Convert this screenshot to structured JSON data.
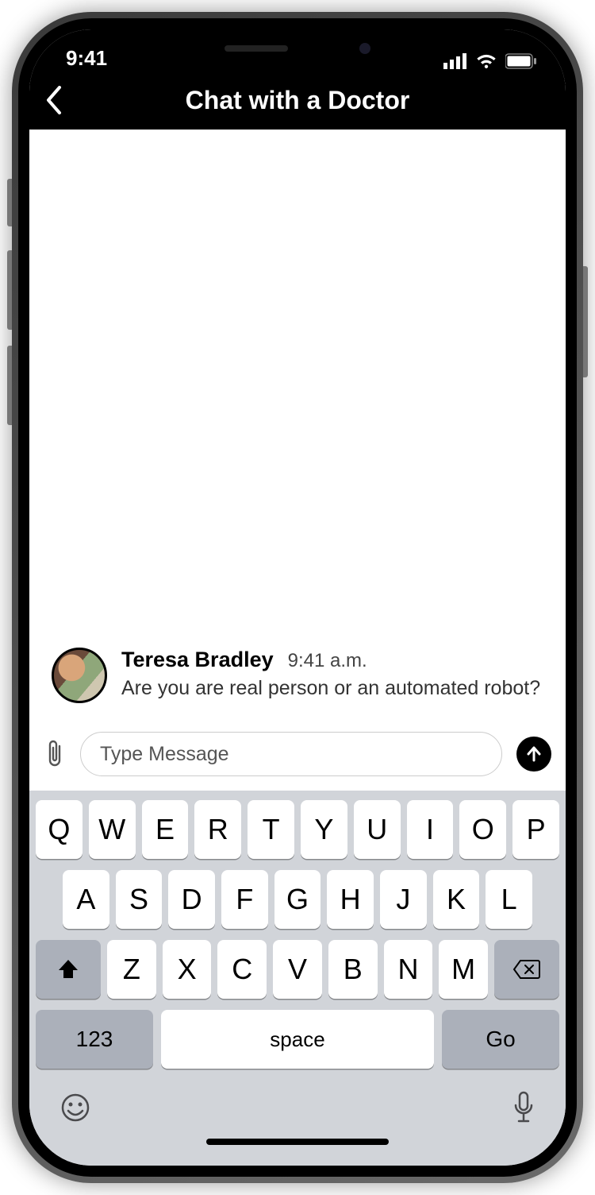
{
  "status": {
    "time": "9:41"
  },
  "header": {
    "title": "Chat with a Doctor"
  },
  "message": {
    "sender": "Teresa Bradley",
    "time": "9:41 a.m.",
    "text": "Are you are real person or an automated robot?"
  },
  "composer": {
    "placeholder": "Type Message"
  },
  "keyboard": {
    "row1": [
      "Q",
      "W",
      "E",
      "R",
      "T",
      "Y",
      "U",
      "I",
      "O",
      "P"
    ],
    "row2": [
      "A",
      "S",
      "D",
      "F",
      "G",
      "H",
      "J",
      "K",
      "L"
    ],
    "row3": [
      "Z",
      "X",
      "C",
      "V",
      "B",
      "N",
      "M"
    ],
    "num_label": "123",
    "space_label": "space",
    "go_label": "Go"
  }
}
